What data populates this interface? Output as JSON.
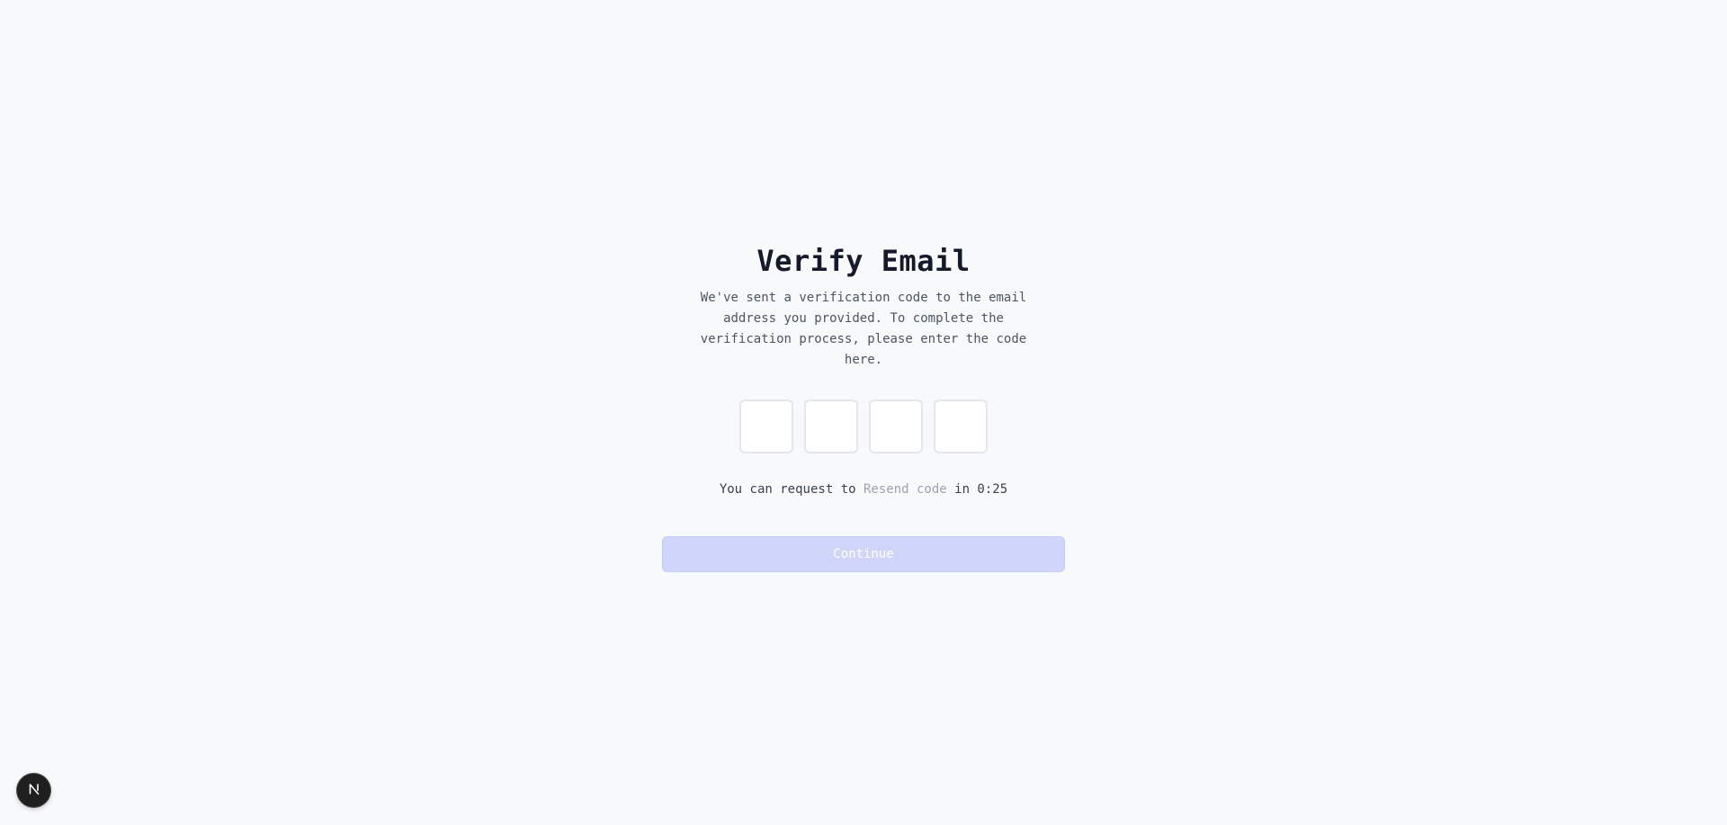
{
  "page": {
    "title": "Verify Email",
    "subtitle": "We've sent a verification code to the email address you provided. To complete the verification process, please enter the code here."
  },
  "code_inputs": [
    {
      "value": ""
    },
    {
      "value": ""
    },
    {
      "value": ""
    },
    {
      "value": ""
    }
  ],
  "resend": {
    "prefix": "You can request to",
    "link_label": "Resend code",
    "suffix": "in 0:25"
  },
  "continue_button": {
    "label": "Continue",
    "disabled": true
  },
  "dev_badge": {
    "icon": "nextjs-logo-icon",
    "letter": "N"
  },
  "colors": {
    "background": "#f8f9fb",
    "title": "#141a2b",
    "button_disabled_bg": "#d0d6f9",
    "link_disabled": "#9ca3af"
  }
}
